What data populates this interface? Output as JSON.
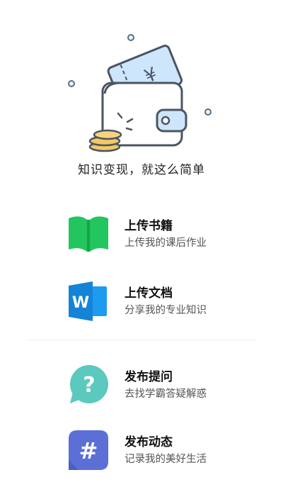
{
  "header": {
    "slogan": "知识变现，就这么简单",
    "illustration_icon": "wallet-ticket-coins-illustration",
    "currency_symbol": "¥"
  },
  "menu": [
    {
      "title": "上传书籍",
      "subtitle": "上传我的课后作业",
      "icon": "book-icon",
      "color": "#22C55E"
    },
    {
      "title": "上传文档",
      "subtitle": "分享我的专业知识",
      "icon": "word-doc-icon",
      "color": "#1D9BF0"
    },
    {
      "title": "发布提问",
      "subtitle": "去找学霸答疑解惑",
      "icon": "question-icon",
      "color": "#5BC9BD"
    },
    {
      "title": "发布动态",
      "subtitle": "记录我的美好生活",
      "icon": "hashtag-icon",
      "color": "#5B6FD6"
    }
  ],
  "doc_icon_letter": "W",
  "question_icon_glyph": "?",
  "hashtag_icon_glyph": "#"
}
